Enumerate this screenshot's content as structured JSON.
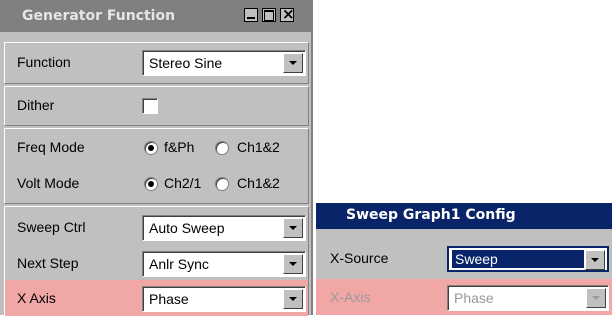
{
  "generator_window": {
    "title": "Generator Function",
    "function": {
      "label": "Function",
      "value": "Stereo Sine"
    },
    "dither": {
      "label": "Dither",
      "checked": false
    },
    "freq_mode": {
      "label": "Freq Mode",
      "options": [
        "f&Ph",
        "Ch1&2"
      ],
      "selected": "f&Ph"
    },
    "volt_mode": {
      "label": "Volt Mode",
      "options": [
        "Ch2/1",
        "Ch1&2"
      ],
      "selected": "Ch2/1"
    },
    "sweep_ctrl": {
      "label": "Sweep Ctrl",
      "value": "Auto Sweep"
    },
    "next_step": {
      "label": "Next Step",
      "value": "Anlr Sync"
    },
    "x_axis": {
      "label": "X Axis",
      "value": "Phase"
    }
  },
  "sweep_config": {
    "title": "Sweep Graph1 Config",
    "x_source": {
      "label": "X-Source",
      "value": "Sweep"
    },
    "x_axis": {
      "label": "X-Axis",
      "value": "Phase"
    }
  },
  "colors": {
    "highlight_row": "#f2a7a7",
    "titlebar_inactive": "#808080",
    "titlebar_active": "#0a246a",
    "panel_bg": "#c0c0c0"
  }
}
